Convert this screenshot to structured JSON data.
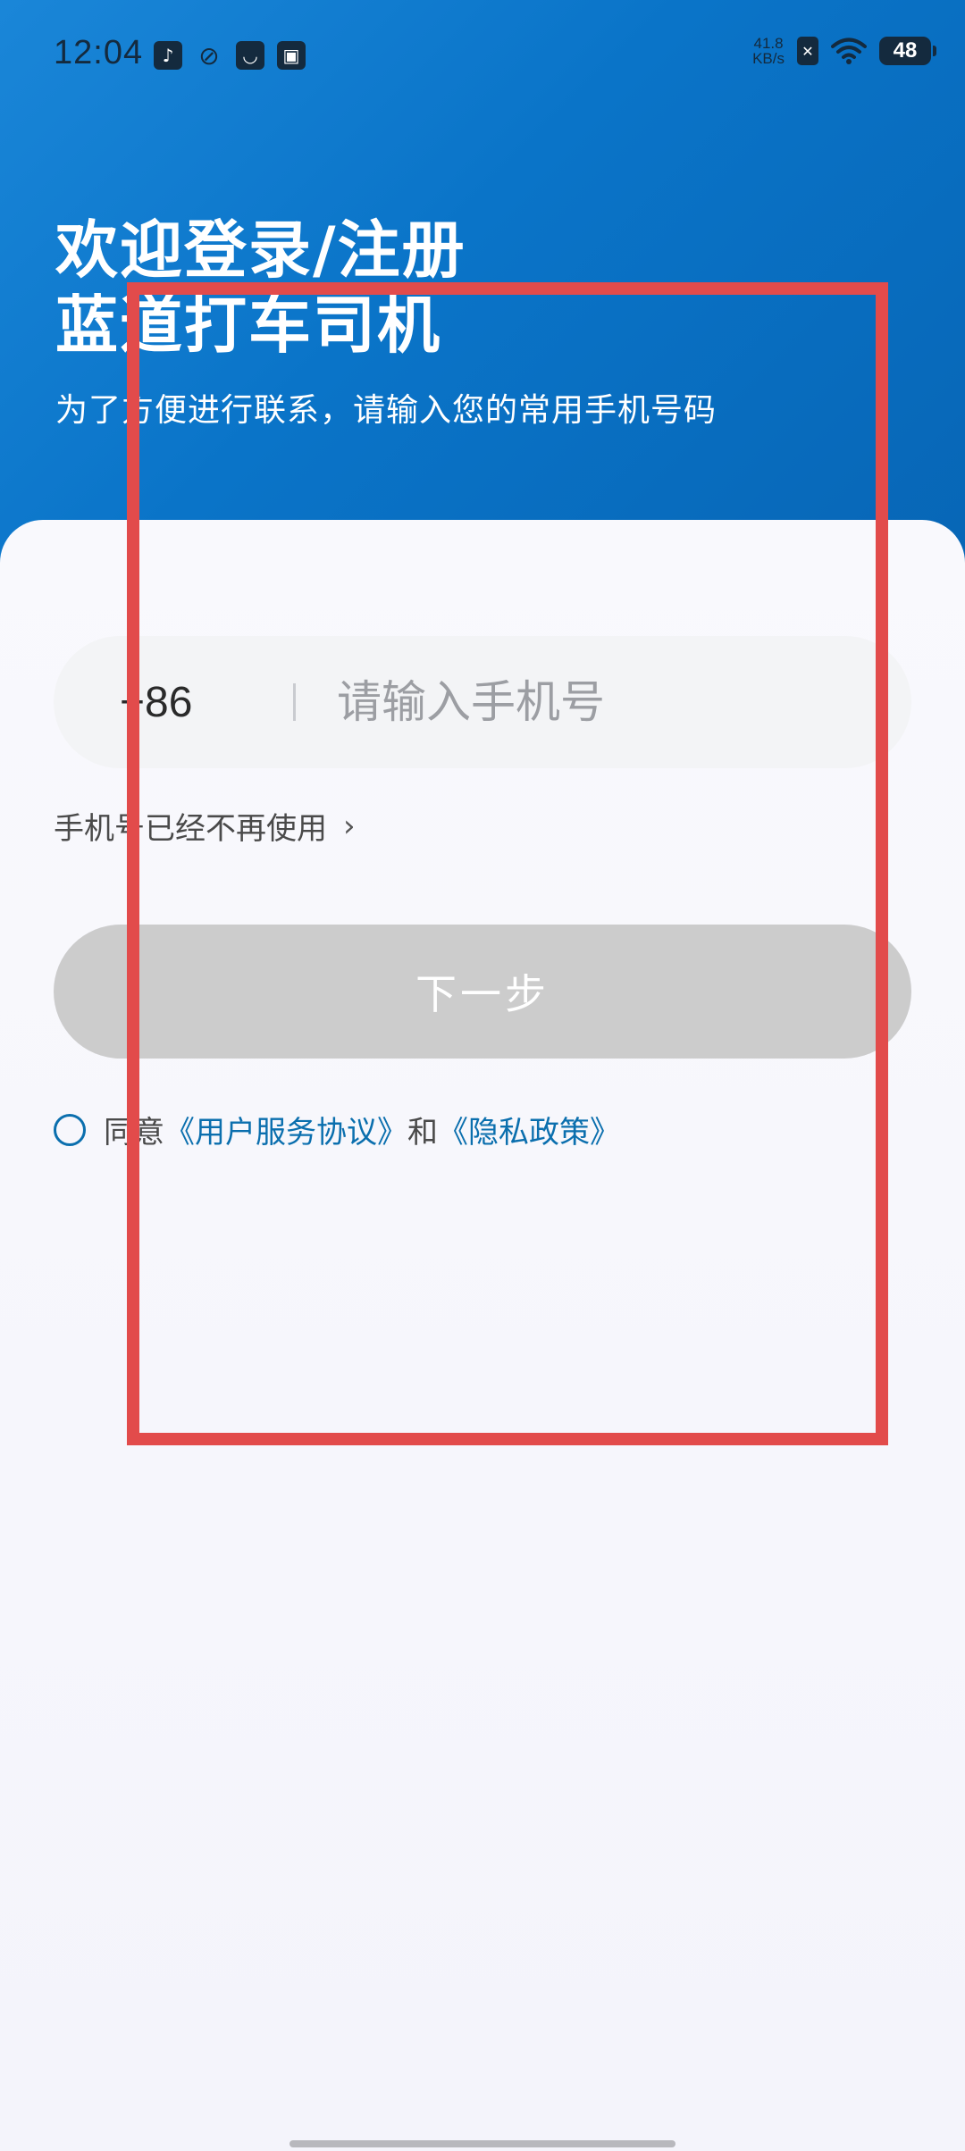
{
  "status_bar": {
    "time": "12:04",
    "net_speed_value": "41.8",
    "net_speed_unit": "KB/s",
    "battery": "48"
  },
  "header": {
    "title_line1": "欢迎登录/注册",
    "title_line2": "蓝道打车司机",
    "subtitle": "为了方便进行联系，请输入您的常用手机号码"
  },
  "form": {
    "country_code": "+86",
    "phone_placeholder": "请输入手机号",
    "phone_value": "",
    "no_longer_label": "手机号已经不再使用",
    "next_label": "下一步",
    "agree_prefix": "同意",
    "agree_terms": "《用户服务协议》",
    "agree_and": "和",
    "agree_privacy": "《隐私政策》"
  },
  "colors": {
    "brand_blue": "#0a74c8",
    "link": "#0b6fae",
    "button_disabled": "#cccccc",
    "highlight": "#e24b4b"
  }
}
